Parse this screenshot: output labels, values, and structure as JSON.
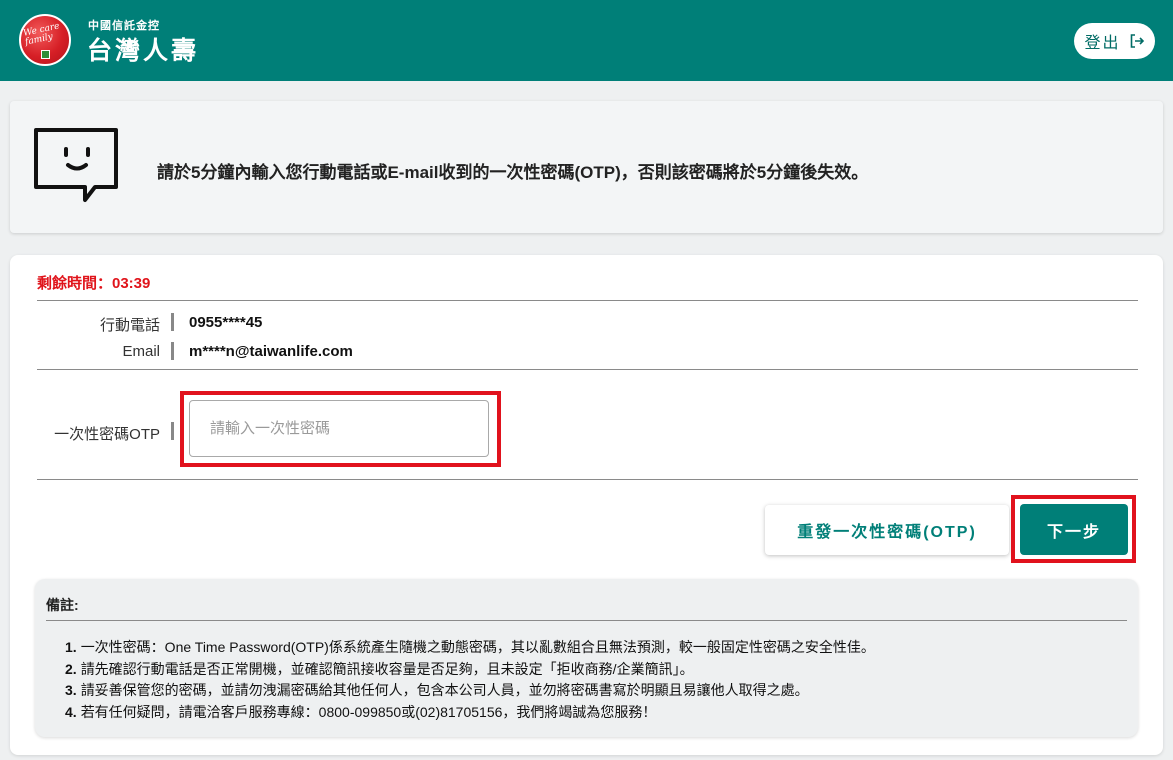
{
  "header": {
    "brand_small": "中國信託金控",
    "brand_big": "台灣人壽",
    "logo_script": "We care family",
    "logout_label": "登出",
    "color": "#007f78"
  },
  "notice": {
    "text": "請於5分鐘內輸入您行動電話或E-mail收到的一次性密碼(OTP)，否則該密碼將於5分鐘後失效。"
  },
  "timer": {
    "text": "剩餘時間：03:39"
  },
  "contact": {
    "phone_label": "行動電話",
    "phone_value": "0955****45",
    "email_label": "Email",
    "email_value": "m****n@taiwanlife.com"
  },
  "otp": {
    "label": "一次性密碼OTP",
    "value": "",
    "placeholder": "請輸入一次性密碼"
  },
  "buttons": {
    "resend": "重發一次性密碼(OTP)",
    "next": "下一步"
  },
  "remarks": {
    "title": "備註:",
    "items": [
      {
        "num": "1.",
        "text": "一次性密碼：One Time Password(OTP)係系統產生隨機之動態密碼，其以亂數組合且無法預測，較一般固定性密碼之安全性佳。"
      },
      {
        "num": "2.",
        "text": "請先確認行動電話是否正常開機，並確認簡訊接收容量是否足夠，且未設定「拒收商務/企業簡訊」。"
      },
      {
        "num": "3.",
        "text": "請妥善保管您的密碼，並請勿洩漏密碼給其他任何人，包含本公司人員，並勿將密碼書寫於明顯且易讓他人取得之處。"
      },
      {
        "num": "4.",
        "text": "若有任何疑問，請電洽客戶服務專線：0800-099850或(02)81705156，我們將竭誠為您服務！"
      }
    ]
  }
}
